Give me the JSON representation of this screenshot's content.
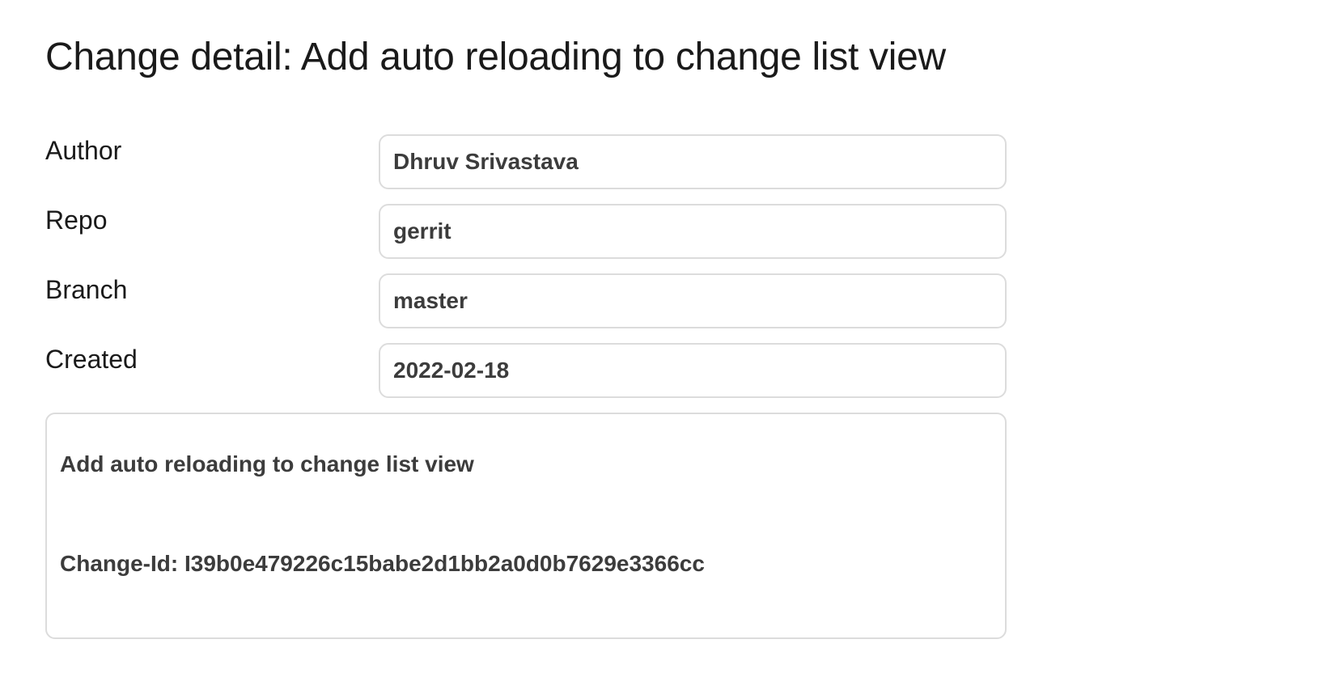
{
  "page": {
    "title": "Change detail: Add auto reloading to change list view"
  },
  "fields": [
    {
      "label": "Author",
      "value": "Dhruv Srivastava"
    },
    {
      "label": "Repo",
      "value": "gerrit"
    },
    {
      "label": "Branch",
      "value": "master"
    },
    {
      "label": "Created",
      "value": "2022-02-18"
    }
  ],
  "commit_message": {
    "subject": "Add auto reloading to change list view",
    "change_id": "Change-Id: I39b0e479226c15babe2d1bb2a0d0b7629e3366cc"
  }
}
